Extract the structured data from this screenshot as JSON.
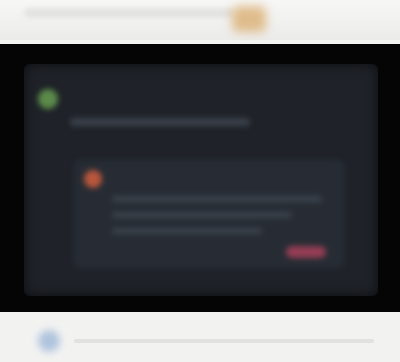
{
  "header": {
    "title": ""
  },
  "card": {
    "title": ""
  },
  "colors": {
    "page_background": "#f4f4f3",
    "video_background": "#050505",
    "screen_background": "#1f2329",
    "logo_green": "#5b8a4a",
    "alert_red": "#b8563c",
    "badge_pink": "#a8415a",
    "top_accent": "#d8a660"
  },
  "icons": {
    "logo": "logo-icon",
    "alert": "alert-icon",
    "play": "play-icon"
  }
}
